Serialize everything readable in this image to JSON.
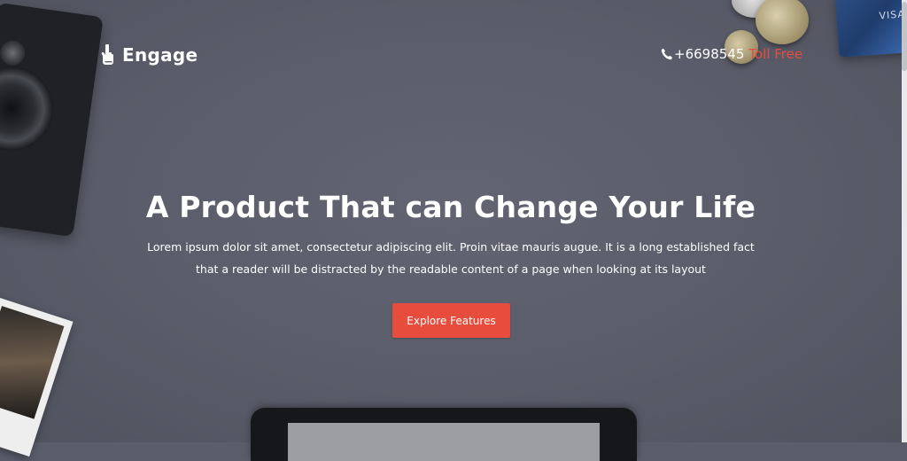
{
  "brand": {
    "name": "Engage",
    "logo_icon": "hand-pointer-icon"
  },
  "contact": {
    "phone_icon": "phone-icon",
    "phone": "+6698545",
    "label": "Toll Free"
  },
  "hero": {
    "title": "A Product That can Change Your Life",
    "description": "Lorem ipsum dolor sit amet, consectetur adipiscing elit. Proin vitae mauris augue. It is a long established fact that a reader will be distracted by the readable content of a page when looking at its layout",
    "cta_label": "Explore Features"
  },
  "colors": {
    "accent": "#e74c3c",
    "background": "#5b5d6b",
    "text": "#ffffff"
  }
}
